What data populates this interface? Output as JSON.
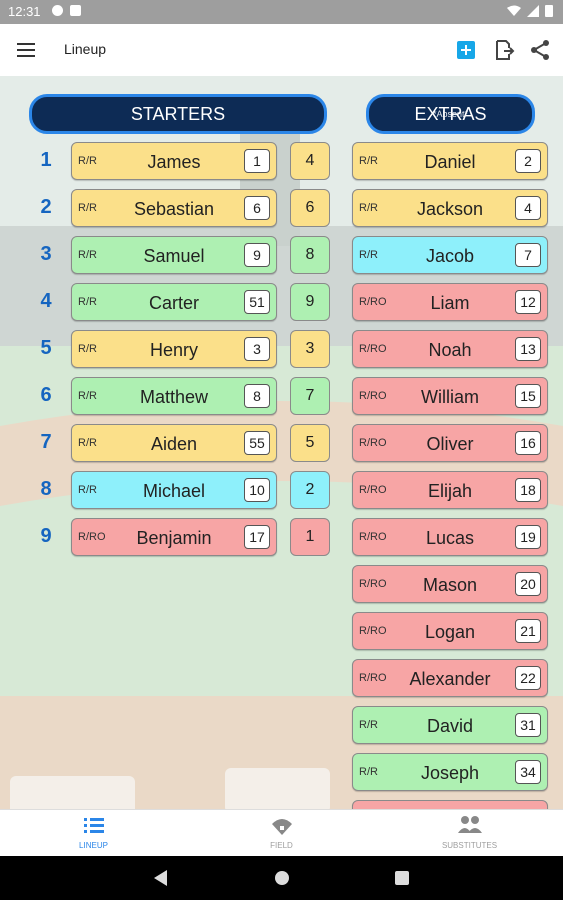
{
  "status": {
    "time": "12:31"
  },
  "appbar": {
    "title": "Lineup",
    "menu_icon": "hamburger-menu-icon",
    "actions": [
      "add-icon",
      "export-icon",
      "share-icon"
    ]
  },
  "starters": {
    "title": "STARTERS",
    "rows": [
      {
        "order": "1",
        "bt": "R/R",
        "name": "James",
        "number": "1",
        "pos": "4",
        "color": "yellow"
      },
      {
        "order": "2",
        "bt": "R/R",
        "name": "Sebastian",
        "number": "6",
        "pos": "6",
        "color": "yellow"
      },
      {
        "order": "3",
        "bt": "R/R",
        "name": "Samuel",
        "number": "9",
        "pos": "8",
        "color": "green"
      },
      {
        "order": "4",
        "bt": "R/R",
        "name": "Carter",
        "number": "51",
        "pos": "9",
        "color": "green"
      },
      {
        "order": "5",
        "bt": "R/R",
        "name": "Henry",
        "number": "3",
        "pos": "3",
        "color": "yellow"
      },
      {
        "order": "6",
        "bt": "R/R",
        "name": "Matthew",
        "number": "8",
        "pos": "7",
        "color": "green"
      },
      {
        "order": "7",
        "bt": "R/R",
        "name": "Aiden",
        "number": "55",
        "pos": "5",
        "color": "yellow"
      },
      {
        "order": "8",
        "bt": "R/R",
        "name": "Michael",
        "number": "10",
        "pos": "2",
        "color": "cyan"
      },
      {
        "order": "9",
        "bt": "R/RO",
        "name": "Benjamin",
        "number": "17",
        "pos": "1",
        "color": "red"
      }
    ]
  },
  "extras": {
    "title": "EXTRAS",
    "overlay": "*Absent*",
    "rows": [
      {
        "bt": "R/R",
        "name": "Daniel",
        "number": "2",
        "color": "yellow"
      },
      {
        "bt": "R/R",
        "name": "Jackson",
        "number": "4",
        "color": "yellow"
      },
      {
        "bt": "R/R",
        "name": "Jacob",
        "number": "7",
        "color": "cyan"
      },
      {
        "bt": "R/RO",
        "name": "Liam",
        "number": "12",
        "color": "red"
      },
      {
        "bt": "R/RO",
        "name": "Noah",
        "number": "13",
        "color": "red"
      },
      {
        "bt": "R/RO",
        "name": "William",
        "number": "15",
        "color": "red"
      },
      {
        "bt": "R/RO",
        "name": "Oliver",
        "number": "16",
        "color": "red"
      },
      {
        "bt": "R/RO",
        "name": "Elijah",
        "number": "18",
        "color": "red"
      },
      {
        "bt": "R/RO",
        "name": "Lucas",
        "number": "19",
        "color": "red"
      },
      {
        "bt": "R/RO",
        "name": "Mason",
        "number": "20",
        "color": "red"
      },
      {
        "bt": "R/RO",
        "name": "Logan",
        "number": "21",
        "color": "red"
      },
      {
        "bt": "R/RO",
        "name": "Alexander",
        "number": "22",
        "color": "red"
      },
      {
        "bt": "R/R",
        "name": "David",
        "number": "31",
        "color": "green"
      },
      {
        "bt": "R/R",
        "name": "Joseph",
        "number": "34",
        "color": "green"
      }
    ]
  },
  "bottom_nav": [
    {
      "label": "LINEUP",
      "icon": "list-icon",
      "active": true
    },
    {
      "label": "FIELD",
      "icon": "field-icon",
      "active": false
    },
    {
      "label": "SUBSTITUTES",
      "icon": "people-icon",
      "active": false
    }
  ],
  "colors": {
    "yellow": "#fbe08a",
    "green": "#aef0b2",
    "cyan": "#8ef0fb",
    "red": "#f7a5a5",
    "header_bg": "#0d2b55",
    "header_border": "#2b86e8",
    "accent": "#2b86e8"
  }
}
